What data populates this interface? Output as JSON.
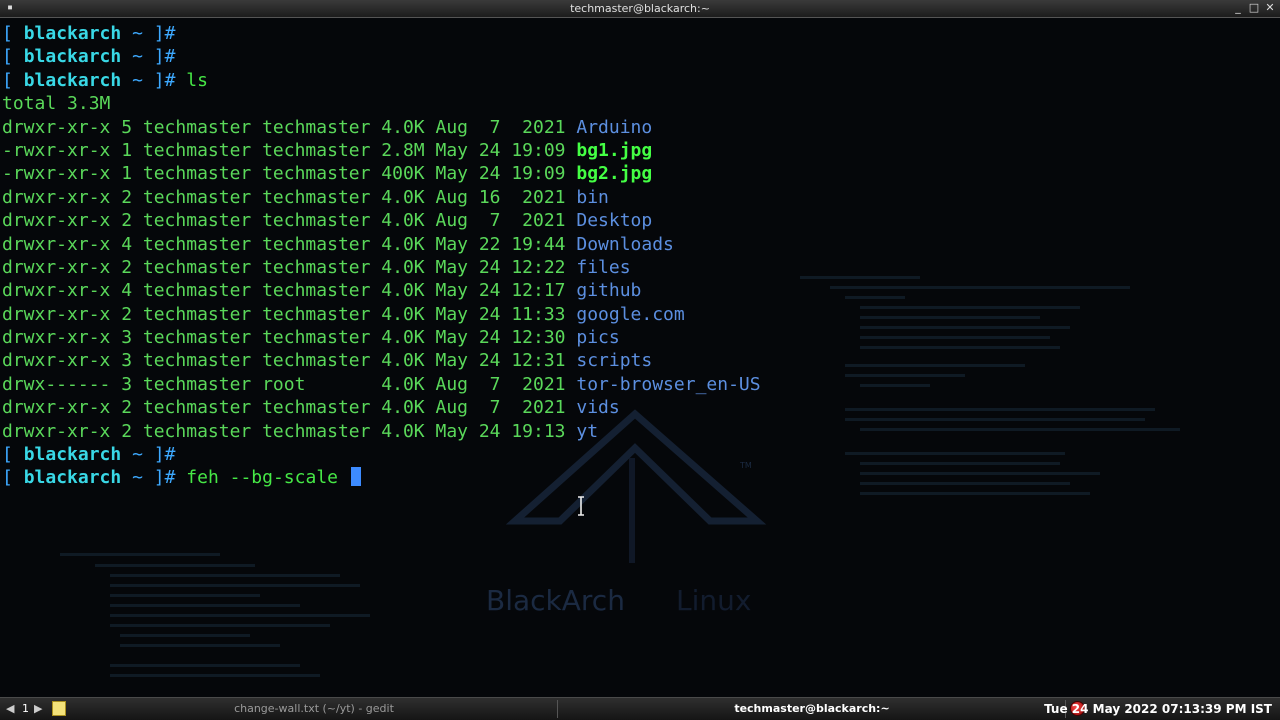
{
  "window": {
    "title": "techmaster@blackarch:~",
    "menu_icon": "menu-dot-icon",
    "controls": [
      "_",
      "□",
      "✕"
    ]
  },
  "prompt": {
    "open": "[ ",
    "host": "blackarch",
    "rest": " ~ ]",
    "hash": "#"
  },
  "terminal": {
    "commands": [
      "",
      "",
      " ls"
    ],
    "total": "total 3.3M",
    "entries": [
      {
        "meta": "drwxr-xr-x 5 techmaster techmaster 4.0K Aug  7  2021 ",
        "name": "Arduino",
        "kind": "dir"
      },
      {
        "meta": "-rwxr-xr-x 1 techmaster techmaster 2.8M May 24 19:09 ",
        "name": "bg1.jpg",
        "kind": "exe"
      },
      {
        "meta": "-rwxr-xr-x 1 techmaster techmaster 400K May 24 19:09 ",
        "name": "bg2.jpg",
        "kind": "exe"
      },
      {
        "meta": "drwxr-xr-x 2 techmaster techmaster 4.0K Aug 16  2021 ",
        "name": "bin",
        "kind": "dir"
      },
      {
        "meta": "drwxr-xr-x 2 techmaster techmaster 4.0K Aug  7  2021 ",
        "name": "Desktop",
        "kind": "dir"
      },
      {
        "meta": "drwxr-xr-x 4 techmaster techmaster 4.0K May 22 19:44 ",
        "name": "Downloads",
        "kind": "dir"
      },
      {
        "meta": "drwxr-xr-x 2 techmaster techmaster 4.0K May 24 12:22 ",
        "name": "files",
        "kind": "dir"
      },
      {
        "meta": "drwxr-xr-x 4 techmaster techmaster 4.0K May 24 12:17 ",
        "name": "github",
        "kind": "dir"
      },
      {
        "meta": "drwxr-xr-x 2 techmaster techmaster 4.0K May 24 11:33 ",
        "name": "google.com",
        "kind": "dir"
      },
      {
        "meta": "drwxr-xr-x 3 techmaster techmaster 4.0K May 24 12:30 ",
        "name": "pics",
        "kind": "dir"
      },
      {
        "meta": "drwxr-xr-x 3 techmaster techmaster 4.0K May 24 12:31 ",
        "name": "scripts",
        "kind": "dir"
      },
      {
        "meta": "drwx------ 3 techmaster root       4.0K Aug  7  2021 ",
        "name": "tor-browser_en-US",
        "kind": "dir"
      },
      {
        "meta": "drwxr-xr-x 2 techmaster techmaster 4.0K Aug  7  2021 ",
        "name": "vids",
        "kind": "dir"
      },
      {
        "meta": "drwxr-xr-x 2 techmaster techmaster 4.0K May 24 19:13 ",
        "name": "yt",
        "kind": "dir"
      }
    ],
    "after_commands": [
      "",
      " feh --bg-scale "
    ]
  },
  "wallpaper": {
    "logo_text_1": "BlackArch",
    "logo_text_2": "Linux",
    "tm": "TM"
  },
  "taskbar": {
    "ws_prev": "◀",
    "workspace": "1",
    "ws_next": "▶",
    "task_inactive": "change-wall.txt (~/yt) - gedit",
    "task_active": "techmaster@blackarch:~",
    "clock": "Tue 24 May 2022 07:13:39 PM IST"
  },
  "colors": {
    "dir": "#5c8fe0",
    "exe": "#44ff44",
    "text": "#5fe35f",
    "prompt_host": "#39d8e6",
    "cursor": "#3d8bff"
  }
}
